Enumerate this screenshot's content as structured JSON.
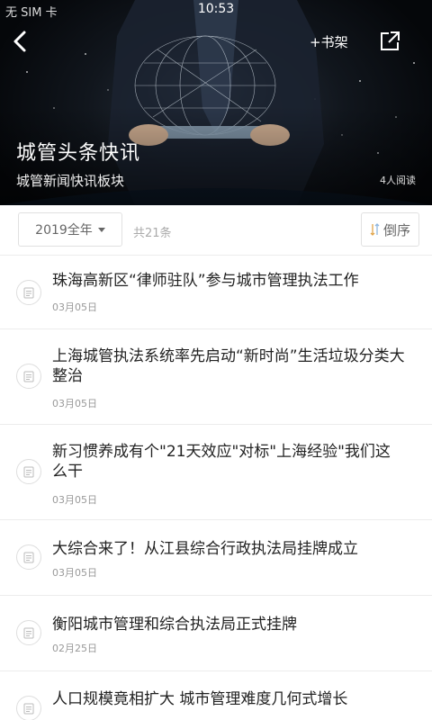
{
  "status": {
    "carrier": "无 SIM 卡",
    "time": "10:53"
  },
  "nav": {
    "shelf_label": "+书架"
  },
  "header": {
    "title": "城管头条快讯",
    "subtitle": "城管新闻快讯板块",
    "readers": "4人阅读"
  },
  "filter": {
    "year": "2019全年",
    "count": "共21条",
    "sort_label": "倒序"
  },
  "articles": [
    {
      "title": "珠海高新区“律师驻队”参与城市管理执法工作",
      "date": "03月05日"
    },
    {
      "title": "上海城管执法系统率先启动“新时尚”生活垃圾分类大整治",
      "date": "03月05日"
    },
    {
      "title": "新习惯养成有个\"21天效应\"对标\"上海经验\"我们这么干",
      "date": "03月05日"
    },
    {
      "title": "大综合来了！从江县综合行政执法局挂牌成立",
      "date": "03月05日"
    },
    {
      "title": "衡阳城市管理和综合执法局正式挂牌",
      "date": "02月25日"
    },
    {
      "title": "人口规模竟相扩大 城市管理难度几何式增长",
      "date": ""
    }
  ]
}
